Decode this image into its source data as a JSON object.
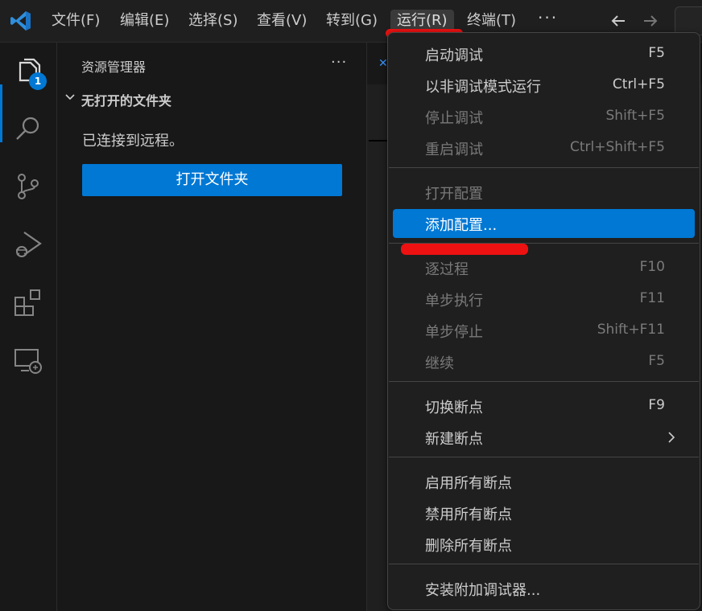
{
  "menubar": {
    "items": [
      "文件(F)",
      "编辑(E)",
      "选择(S)",
      "查看(V)",
      "转到(G)",
      "运行(R)",
      "终端(T)"
    ],
    "more": "···"
  },
  "activitybar": {
    "explorer_badge": "1",
    "icons": [
      "explorer-icon",
      "search-icon",
      "source-control-icon",
      "run-debug-icon",
      "extensions-icon",
      "remote-explorer-icon"
    ]
  },
  "sidebar": {
    "title": "资源管理器",
    "more": "···",
    "section_title": "无打开的文件夹",
    "remote_text": "已连接到远程。",
    "open_folder_button": "打开文件夹"
  },
  "run_menu": {
    "groups": [
      [
        {
          "label": "启动调试",
          "shortcut": "F5",
          "disabled": false
        },
        {
          "label": "以非调试模式运行",
          "shortcut": "Ctrl+F5",
          "disabled": false
        },
        {
          "label": "停止调试",
          "shortcut": "Shift+F5",
          "disabled": true
        },
        {
          "label": "重启调试",
          "shortcut": "Ctrl+Shift+F5",
          "disabled": true
        }
      ],
      [
        {
          "label": "打开配置",
          "shortcut": "",
          "disabled": true
        },
        {
          "label": "添加配置...",
          "shortcut": "",
          "disabled": false,
          "selected": true
        }
      ],
      [
        {
          "label": "逐过程",
          "shortcut": "F10",
          "disabled": true
        },
        {
          "label": "单步执行",
          "shortcut": "F11",
          "disabled": true
        },
        {
          "label": "单步停止",
          "shortcut": "Shift+F11",
          "disabled": true
        },
        {
          "label": "继续",
          "shortcut": "F5",
          "disabled": true
        }
      ],
      [
        {
          "label": "切换断点",
          "shortcut": "F9",
          "disabled": false
        },
        {
          "label": "新建断点",
          "shortcut": "",
          "disabled": false,
          "submenu": true
        }
      ],
      [
        {
          "label": "启用所有断点",
          "shortcut": "",
          "disabled": false
        },
        {
          "label": "禁用所有断点",
          "shortcut": "",
          "disabled": false
        },
        {
          "label": "删除所有断点",
          "shortcut": "",
          "disabled": false
        }
      ],
      [
        {
          "label": "安装附加调试器...",
          "shortcut": "",
          "disabled": false
        }
      ]
    ]
  },
  "colors": {
    "accent": "#0078d4",
    "annotation": "#ee1111",
    "background": "#1f1f1f",
    "sidebar": "#181818"
  }
}
